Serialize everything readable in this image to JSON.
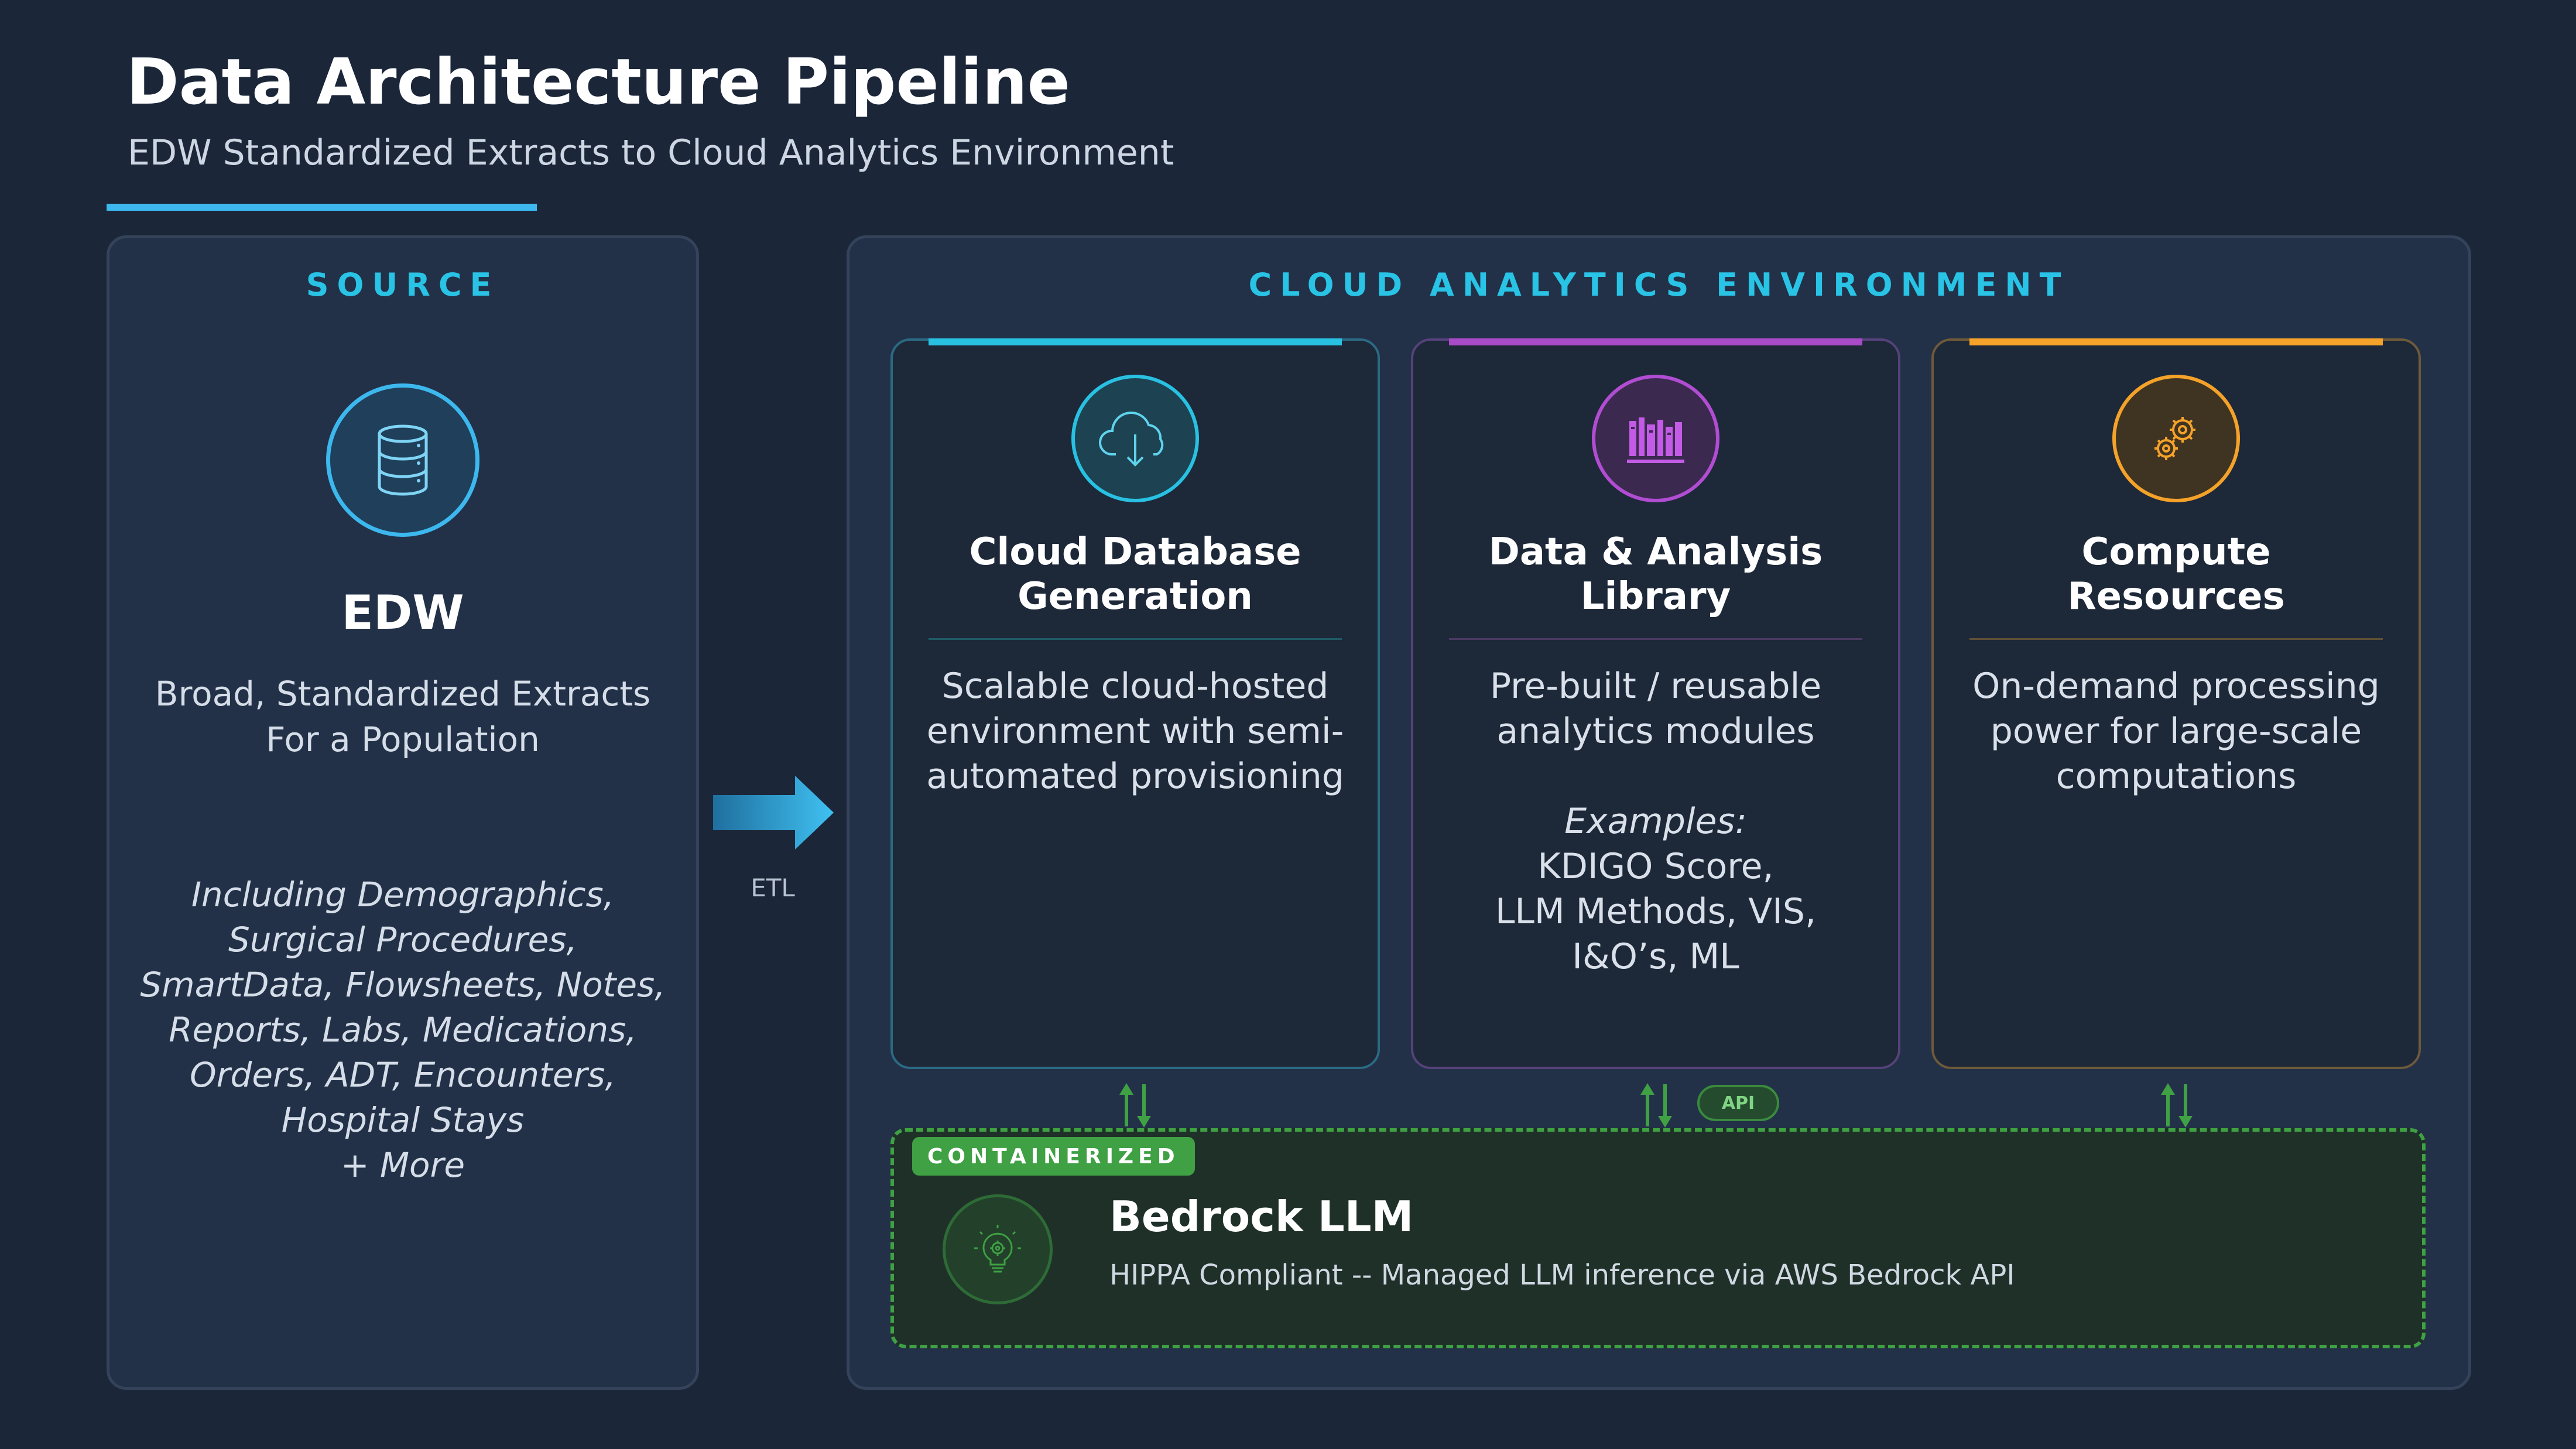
{
  "header": {
    "title": "Data Architecture Pipeline",
    "subtitle": "EDW Standardized Extracts to Cloud Analytics Environment"
  },
  "source": {
    "section_label": "SOURCE",
    "icon": "database-icon",
    "title": "EDW",
    "description_lines": [
      "Broad, Standardized Extracts",
      "For a Population"
    ],
    "includes_lines": [
      "Including Demographics,",
      "Surgical Procedures,",
      "SmartData, Flowsheets, Notes,",
      "Reports, Labs, Medications,",
      "Orders, ADT, Encounters,",
      "Hospital Stays",
      "+ More"
    ]
  },
  "connector": {
    "label": "ETL"
  },
  "cloud": {
    "section_label": "CLOUD ANALYTICS ENVIRONMENT",
    "cards": [
      {
        "icon": "cloud-download-icon",
        "title_lines": [
          "Cloud Database",
          "Generation"
        ],
        "description_lines": [
          "Scalable cloud-hosted",
          "environment with semi-",
          "automated provisioning"
        ],
        "accent": "#28c1e2"
      },
      {
        "icon": "library-books-icon",
        "title_lines": [
          "Data & Analysis",
          "Library"
        ],
        "description_lines": [
          "Pre-built / reusable",
          "analytics modules"
        ],
        "examples_label": "Examples:",
        "examples_lines": [
          "KDIGO Score,",
          "LLM Methods, VIS,",
          "I&O’s, ML"
        ],
        "accent": "#a94ac8"
      },
      {
        "icon": "gears-icon",
        "title_lines": [
          "Compute",
          "Resources"
        ],
        "description_lines": [
          "On-demand processing",
          "power for large-scale",
          "computations"
        ],
        "accent": "#f4a229"
      }
    ],
    "api_badge": "API",
    "llm": {
      "badge": "CONTAINERIZED",
      "icon": "lightbulb-gear-icon",
      "title": "Bedrock LLM",
      "description": "HIPPA Compliant -- Managed LLM inference via AWS Bedrock API",
      "accent": "#3fa044"
    }
  }
}
